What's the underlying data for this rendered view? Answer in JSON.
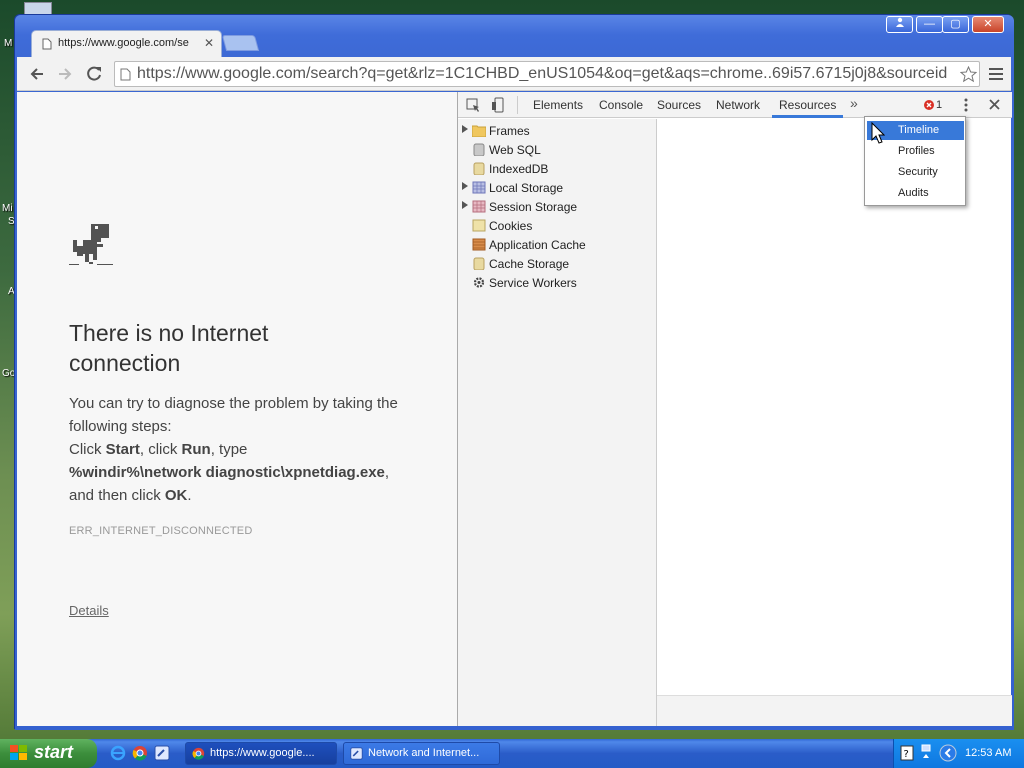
{
  "desktop": {
    "labels": [
      "M",
      "Mi",
      "S",
      "A",
      "Go"
    ]
  },
  "window": {
    "controls": [
      "user",
      "minimize",
      "maximize",
      "close"
    ]
  },
  "tabs": [
    {
      "title": "https://www.google.com/se"
    }
  ],
  "toolbar": {
    "url": "https://www.google.com/search?q=get&rlz=1C1CHBD_enUS1054&oq=get&aqs=chrome..69i57.6715j0j8&sourceid"
  },
  "page": {
    "title": "There is no Internet connection",
    "desc_intro": "You can try to diagnose the problem by taking the following steps:",
    "click1": "Click ",
    "start": "Start",
    "click2": ", click ",
    "run": "Run",
    "type": ", type",
    "command": "%windir%\\network diagnostic\\xpnetdiag.exe",
    "then": ", and then click ",
    "ok": "OK",
    "period": ".",
    "error_code": "ERR_INTERNET_DISCONNECTED",
    "details": "Details"
  },
  "devtools": {
    "tabs": [
      "Elements",
      "Console",
      "Sources",
      "Network",
      "Resources"
    ],
    "more": "»",
    "error_count": "1",
    "tree": [
      "Frames",
      "Web SQL",
      "IndexedDB",
      "Local Storage",
      "Session Storage",
      "Cookies",
      "Application Cache",
      "Cache Storage",
      "Service Workers"
    ],
    "menu": [
      "Timeline",
      "Profiles",
      "Security",
      "Audits"
    ]
  },
  "taskbar": {
    "start": "start",
    "tasks": [
      "https://www.google....",
      "Network and Internet..."
    ],
    "time": "12:53 AM"
  },
  "colors": {
    "accent": "#3879d9",
    "taskbar": "#245bc6",
    "start": "#3c8e3c"
  }
}
